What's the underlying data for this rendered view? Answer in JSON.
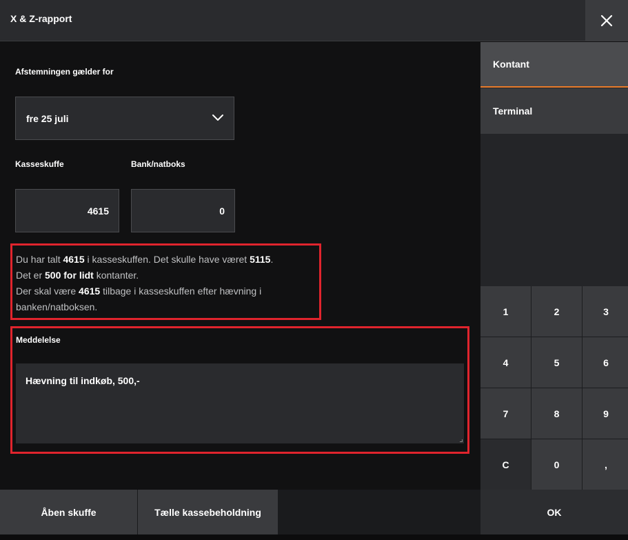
{
  "header": {
    "title": "X & Z-rapport"
  },
  "form": {
    "date_label": "Afstemningen gælder for",
    "date_value": "fre 25 juli",
    "drawer_label": "Kasseskuffe",
    "drawer_value": "4615",
    "bank_label": "Bank/natboks",
    "bank_value": "0"
  },
  "info": {
    "l1_a": "Du har talt ",
    "l1_b": "4615",
    "l1_c": " i kasseskuffen. Det skulle have været ",
    "l1_d": "5115",
    "l1_e": ".",
    "l2_a": "Det er ",
    "l2_b": "500 for lidt",
    "l2_c": " kontanter.",
    "l3_a": "Der skal være ",
    "l3_b": "4615",
    "l3_c": " tilbage i kasseskuffen efter hævning i",
    "l4": "banken/natboksen."
  },
  "message": {
    "label": "Meddelelse",
    "value": "Hævning til indkøb, 500,-"
  },
  "tabs": {
    "cash": "Kontant",
    "terminal": "Terminal"
  },
  "keypad": [
    "1",
    "2",
    "3",
    "4",
    "5",
    "6",
    "7",
    "8",
    "9",
    "C",
    "0",
    ","
  ],
  "footer": {
    "open_drawer": "Åben skuffe",
    "count_cash": "Tælle kassebeholdning",
    "ok": "OK"
  },
  "colors": {
    "highlight": "#e0242d",
    "active_tab_underline": "#ea7b2a"
  },
  "icons": {
    "close": "close-icon",
    "dropdown": "chevron-down-icon"
  }
}
